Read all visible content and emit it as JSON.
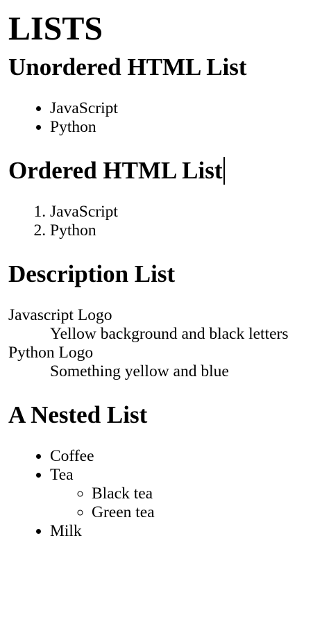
{
  "title": "LISTS",
  "unordered": {
    "heading": "Unordered HTML List",
    "items": [
      "JavaScript",
      "Python"
    ]
  },
  "ordered": {
    "heading": "Ordered HTML List",
    "items": [
      "JavaScript",
      "Python"
    ]
  },
  "description": {
    "heading": "Description List",
    "entries": [
      {
        "term": "Javascript Logo",
        "definition": "Yellow background and black letters"
      },
      {
        "term": "Python Logo",
        "definition": "Something yellow and blue"
      }
    ]
  },
  "nested": {
    "heading": "A Nested List",
    "items": [
      "Coffee",
      "Tea",
      "Milk"
    ],
    "tea_subitems": [
      "Black tea",
      "Green tea"
    ]
  }
}
